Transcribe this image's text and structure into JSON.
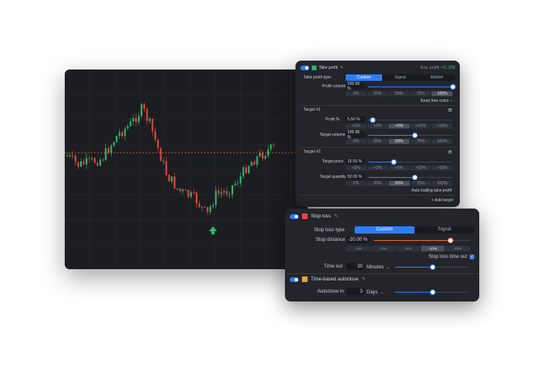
{
  "chart": {
    "colors": {
      "up": "#2fb86f",
      "down": "#e8463d",
      "grid": "#2a2c33",
      "priceline": "#e36a2c",
      "bg": "#1c1d21"
    }
  },
  "take_profit": {
    "title": "Take profit",
    "exp_profit_label": "Exp. profit",
    "exp_profit_value": "+11.26$",
    "type_label": "Take profit type",
    "type_options": [
      "Custom",
      "Signal",
      "Market"
    ],
    "profit_volume_label": "Profit volume",
    "profit_volume_value": "100.00 %",
    "profit_volume_level": 1.0,
    "volume_chips": [
      "0%",
      "25%",
      "50%",
      "75%",
      "100%"
    ],
    "keep_free_label": "Keep free coins",
    "target1": {
      "title": "Target #1",
      "profit_label": "Profit %",
      "profit_value": "5.50 %",
      "profit_level": 0.05,
      "profit_chips": [
        "+1%",
        "+2%",
        "+5%",
        "+10%",
        "+15%"
      ],
      "volume_label": "Target volume",
      "volume_value": "100.00 %",
      "volume_level": 0.55,
      "volume_chips": [
        "0%",
        "25%",
        "50%",
        "75%",
        "100%"
      ]
    },
    "target2": {
      "title": "Target #2",
      "price_label": "Target price",
      "price_value": "15.50 %",
      "price_level": 0.3,
      "price_chips": [
        "+1%",
        "+2%",
        "+5%",
        "+10%",
        "+15%"
      ],
      "quantity_label": "Target quantity",
      "quantity_value": "50.00 %",
      "quantity_level": 0.55,
      "quantity_chips": [
        "0%",
        "25%",
        "50%",
        "75%",
        "100%"
      ]
    },
    "auto_trailing_label": "Auto trailing take profit",
    "add_target_label": "+ Add target"
  },
  "stop_loss": {
    "title": "Stop loss",
    "type_label": "Stop loss type",
    "type_options": [
      "Custom",
      "Signal"
    ],
    "distance_label": "Stop distance",
    "distance_value": "-20.00 %",
    "distance_level": 0.8,
    "distance_chips": [
      "-1%",
      "-2%",
      "-5%",
      "-10%",
      "-15%"
    ],
    "time_out_toggle_label": "Stop loss time out",
    "time_out_label": "Time out",
    "time_out_value": "30",
    "time_out_unit": "Minutes",
    "time_out_level": 0.5
  },
  "autoclose": {
    "title": "Time-based autoclose",
    "label": "Autoclose in",
    "value": "3",
    "unit": "Days",
    "level": 0.5
  }
}
